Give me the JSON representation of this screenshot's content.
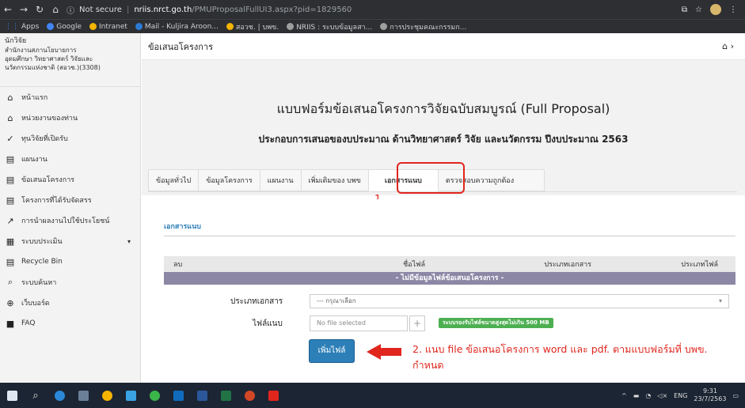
{
  "browser": {
    "security_label": "Not secure",
    "url_host": "nriis.nrct.go.th",
    "url_path": "/PMUProposalFullUI3.aspx?pid=1829560",
    "bookmarks": [
      {
        "label": "Apps",
        "color": "#f4b400"
      },
      {
        "label": "Google",
        "color": "#4285f4"
      },
      {
        "label": "Intranet",
        "color": "#f4b400"
      },
      {
        "label": "Mail - Kuljira Aroon...",
        "color": "#2b7bd6"
      },
      {
        "label": "สอวช. | บพข.",
        "color": "#f4b400"
      },
      {
        "label": "NRIIS : ระบบข้อมูลสา...",
        "color": "#9e9e9e"
      },
      {
        "label": "การประชุมคณะกรรมก...",
        "color": "#9e9e9e"
      }
    ]
  },
  "sidebar": {
    "user_name": "นักวิจัย",
    "org_line1": "สำนักงานสภานโยบายการ",
    "org_line2": "อุดมศึกษา วิทยาศาสตร์ วิจัยและ",
    "org_line3": "นวัตกรรมแห่งชาติ (สอวช.)(3308)",
    "items": [
      {
        "label": "หน้าแรก",
        "icon": "home-icon",
        "glyph": "⌂"
      },
      {
        "label": "หน่วยงานของท่าน",
        "icon": "building-icon",
        "glyph": "⌂"
      },
      {
        "label": "ทุนวิจัยที่เปิดรับ",
        "icon": "funding-icon",
        "glyph": "✓"
      },
      {
        "label": "แผนงาน",
        "icon": "document-icon",
        "glyph": "▤"
      },
      {
        "label": "ข้อเสนอโครงการ",
        "icon": "document-icon",
        "glyph": "▤"
      },
      {
        "label": "โครงการที่ได้รับจัดสรร",
        "icon": "document-icon",
        "glyph": "▤"
      },
      {
        "label": "การนำผลงานไปใช้ประโยชน์",
        "icon": "chart-line-icon",
        "glyph": "↗"
      },
      {
        "label": "ระบบประเมิน",
        "icon": "evaluation-icon",
        "glyph": "▦"
      },
      {
        "label": "Recycle Bin",
        "icon": "recycle-bin-icon",
        "glyph": "▤"
      },
      {
        "label": "ระบบค้นหา",
        "icon": "search-icon",
        "glyph": "⌕"
      },
      {
        "label": "เว็บบอร์ด",
        "icon": "globe-icon",
        "glyph": "⊕"
      },
      {
        "label": "FAQ",
        "icon": "faq-icon",
        "glyph": "■"
      }
    ]
  },
  "main": {
    "breadcrumb": "ข้อเสนอโครงการ",
    "form_title": "แบบฟอร์มข้อเสนอโครงการวิจัยฉบับสมบูรณ์ (Full Proposal)",
    "form_subtitle": "ประกอบการเสนอของบประมาณ ด้านวิทยาศาสตร์ วิจัย และนวัตกรรม ปีงบประมาณ 2563",
    "tabs": [
      "ข้อมูลทั่วไป",
      "ข้อมูลโครงการ",
      "แผนงาน",
      "เพิ่มเติมของ บพข",
      "เอกสารแนบ",
      "ตรวจสอบความถูกต้อง"
    ],
    "annotation_1": "1.",
    "section_title": "เอกสารแนบ",
    "table_headers": [
      "ลบ",
      "ชื่อไฟล์",
      "ประเภทเอกสาร",
      "ประเภทไฟล์"
    ],
    "no_data": "- ไม่มีข้อมูลไฟล์ข้อเสนอโครงการ -",
    "doc_type_label": "ประเภทเอกสาร",
    "doc_type_value": "--- กรุณาเลือก",
    "file_label": "ไฟล์แนบ",
    "file_value": "No file selected",
    "file_note": "ระบบรองรับไฟล์ขนาดสูงสุดไม่เกิน 500 MB",
    "add_button": "เพิ่มไฟล์",
    "annotation_2": "2. แนบ file ข้อเสนอโครงการ word และ pdf. ตามแบบฟอร์มที่ บพข. กำหนด"
  },
  "taskbar": {
    "lang": "ENG",
    "time": "9:31",
    "date": "23/7/2563"
  }
}
